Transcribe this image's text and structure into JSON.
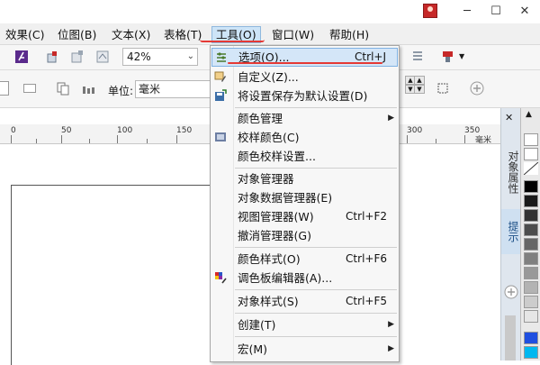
{
  "menubar": {
    "items": [
      {
        "label": "效果(C)"
      },
      {
        "label": "位图(B)"
      },
      {
        "label": "文本(X)"
      },
      {
        "label": "表格(T)"
      },
      {
        "label": "工具(O)"
      },
      {
        "label": "窗口(W)"
      },
      {
        "label": "帮助(H)"
      }
    ],
    "active": "工具(O)"
  },
  "titlebar": {
    "minimize": "─",
    "maximize": "☐",
    "close": "✕"
  },
  "toolbar1": {
    "zoom_value": "42%"
  },
  "toolbar2": {
    "unit_label": "单位:",
    "unit_value": "毫米"
  },
  "ruler": {
    "labels": [
      "0",
      "50",
      "100",
      "150",
      "300",
      "350"
    ],
    "unit": "毫米"
  },
  "dock": {
    "tab1": "对象属性",
    "tab2": "提示"
  },
  "tools_menu": {
    "items": [
      {
        "label": "选项(O)...",
        "shortcut": "Ctrl+J",
        "icon": "options-icon",
        "highlighted": true
      },
      {
        "label": "自定义(Z)...",
        "icon": "customize-icon"
      },
      {
        "label": "将设置保存为默认设置(D)",
        "icon": "save-settings-icon"
      },
      {
        "label": "颜色管理",
        "submenu": true
      },
      {
        "label": "校样颜色(C)",
        "icon": "proof-color-icon"
      },
      {
        "label": "颜色校样设置..."
      },
      {
        "label": "对象管理器"
      },
      {
        "label": "对象数据管理器(E)"
      },
      {
        "label": "视图管理器(W)",
        "shortcut": "Ctrl+F2"
      },
      {
        "label": "撤消管理器(G)"
      },
      {
        "label": "颜色样式(O)",
        "shortcut": "Ctrl+F6"
      },
      {
        "label": "调色板编辑器(A)...",
        "icon": "palette-editor-icon"
      },
      {
        "label": "对象样式(S)",
        "shortcut": "Ctrl+F5"
      },
      {
        "label": "创建(T)",
        "submenu": true
      },
      {
        "label": "宏(M)",
        "submenu": true
      }
    ]
  },
  "colors": {
    "highlight": "#d4e6f8",
    "annotation_red": "#e53935"
  }
}
